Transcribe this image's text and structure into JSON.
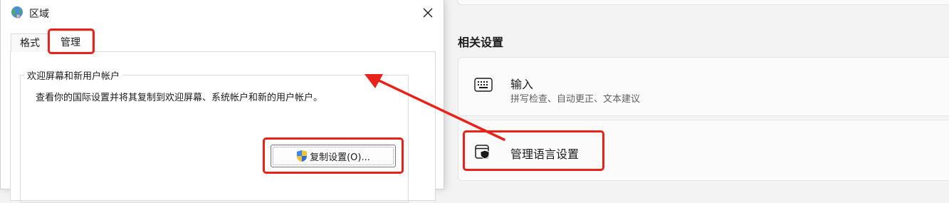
{
  "dialog": {
    "title": "区域",
    "tabs": [
      {
        "label": "格式"
      },
      {
        "label": "管理"
      }
    ],
    "group": {
      "legend": "欢迎屏幕和新用户帐户",
      "description": "查看你的国际设置并将其复制到欢迎屏幕、系统帐户和新的用户帐户。",
      "copy_button": "复制设置(O)..."
    }
  },
  "settings": {
    "section_heading": "相关设置",
    "cards": [
      {
        "title": "输入",
        "subtitle": "拼写检查、自动更正、文本建议",
        "icon": "keyboard-icon"
      },
      {
        "title": "管理语言设置",
        "icon": "shield-window-icon"
      }
    ]
  },
  "annotation": {
    "color": "#e8231b"
  }
}
